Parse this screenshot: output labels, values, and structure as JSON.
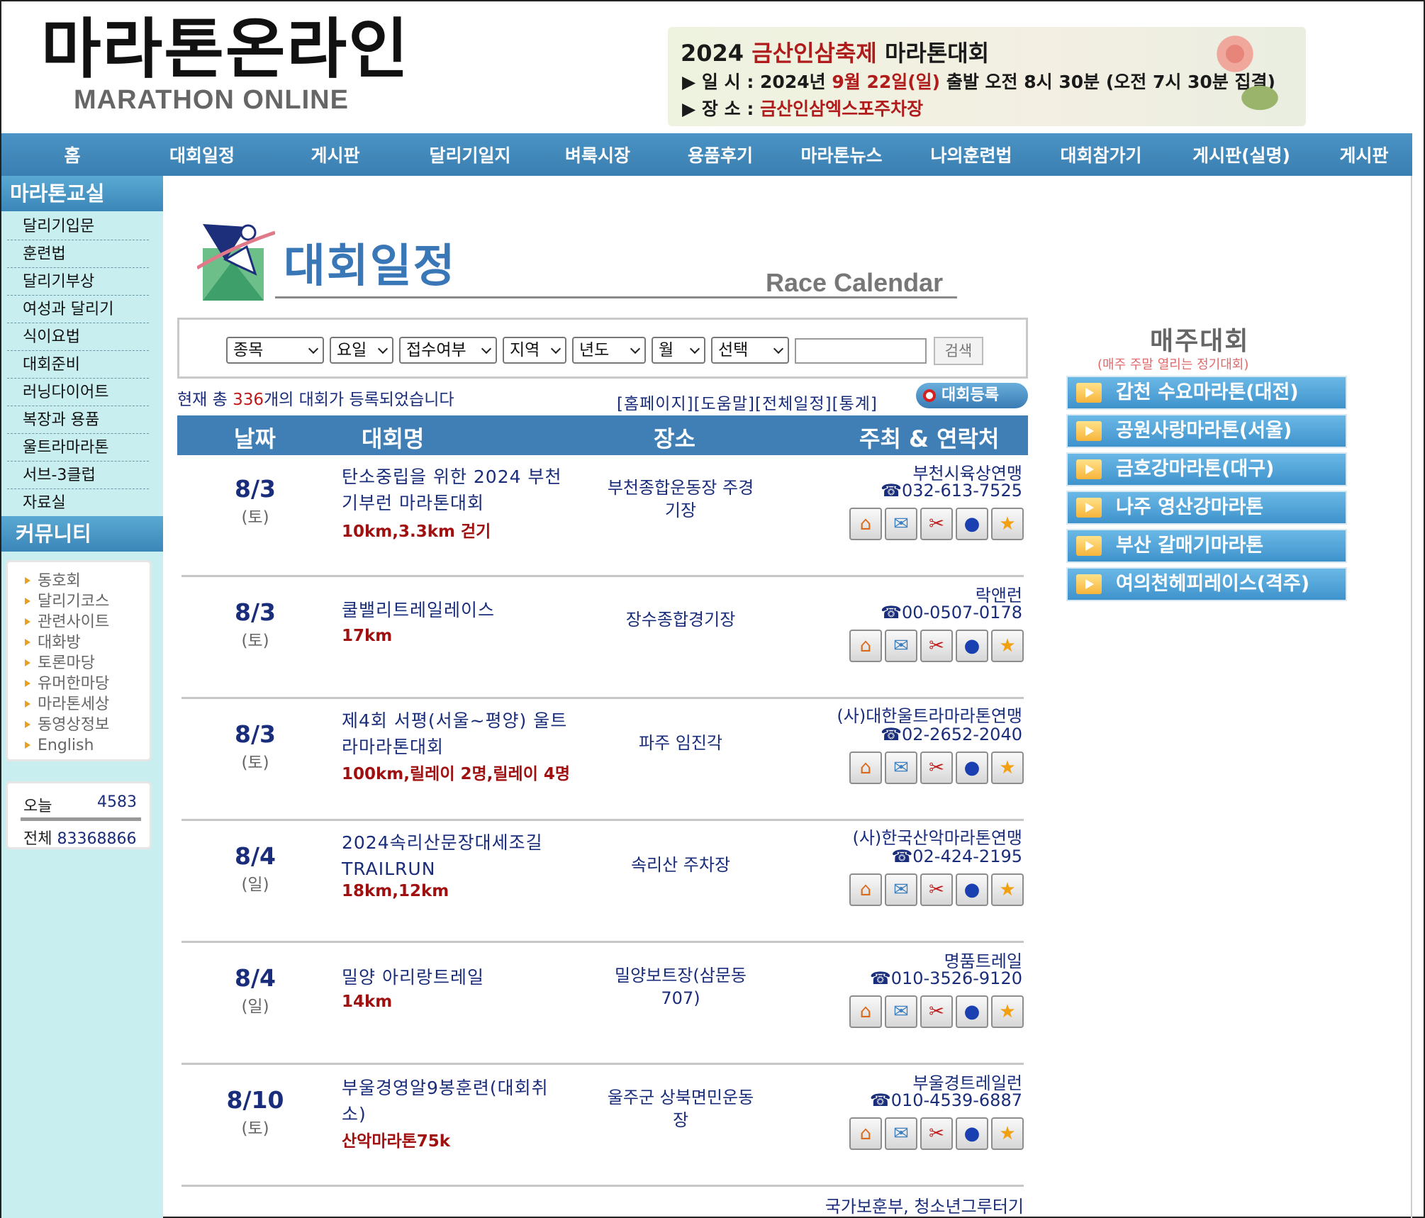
{
  "header": {
    "logo_kr": "마라톤온라인",
    "logo_en": "MARATHON ONLINE",
    "banner": {
      "title_year": "2024",
      "title_name": "금산인삼축제",
      "title_rest": "마라톤대회",
      "line1_label": "▶ 일  시 : 2024년",
      "line1_date": "9월 22일(일)",
      "line1_rest": "출발 오전 8시 30분 (오전 7시 30분 집결)",
      "line2_label": "▶ 장  소 :",
      "line2_place": "금산인삼엑스포주차장"
    }
  },
  "nav": [
    "홈",
    "대회일정",
    "게시판",
    "달리기일지",
    "벼룩시장",
    "용품후기",
    "마라톤뉴스",
    "나의훈련법",
    "대회참가기",
    "게시판(실명)",
    "게시판"
  ],
  "sidebar": {
    "section1": "마라톤교실",
    "menu": [
      "달리기입문",
      "훈련법",
      "달리기부상",
      "여성과 달리기",
      "식이요법",
      "대회준비",
      "러닝다이어트",
      "복장과 용품",
      "울트라마라톤",
      "서브-3클럽",
      "자료실"
    ],
    "section2": "커뮤니티",
    "community": [
      "동호회",
      "달리기코스",
      "관련사이트",
      "대화방",
      "토론마당",
      "유머한마당",
      "마라톤세상",
      "동영상정보",
      "English"
    ],
    "visitors": {
      "today_label": "오늘",
      "today_value": "4583",
      "total_label": "전체",
      "total_value": "83368866"
    }
  },
  "page": {
    "title": "대회일정",
    "subtitle": "Race Calendar"
  },
  "search": {
    "selects": [
      "종목",
      "요일",
      "접수여부",
      "지역",
      "년도",
      "월",
      "선택"
    ],
    "input_value": "",
    "button": "검색"
  },
  "summary": {
    "prefix": "현재 총 ",
    "count": "336",
    "suffix": "개의 대회가 등록되었습니다",
    "links": "[홈페이지][도움말][전체일정][통계]",
    "register": "대회등록"
  },
  "table": {
    "headers": [
      "날짜",
      "대회명",
      "장소",
      "주최 & 연락처"
    ],
    "rows": [
      {
        "date": "8/3",
        "day": "(토)",
        "name1": "탄소중립을 위한 2024 부천",
        "name2": "기부런 마라톤대회",
        "distance": "10km,3.3km 걷기",
        "place1": "부천종합운동장 주경",
        "place2": "기장",
        "org": "부천시육상연맹",
        "phone": "☎032-613-7525"
      },
      {
        "date": "8/3",
        "day": "(토)",
        "name1": "쿨밸리트레일레이스",
        "name2": "",
        "distance": "17km",
        "place1": "장수종합경기장",
        "place2": "",
        "org": "락앤런",
        "phone": "☎00-0507-0178"
      },
      {
        "date": "8/3",
        "day": "(토)",
        "name1": "제4회 서평(서울~평양) 울트",
        "name2": "라마라톤대회",
        "distance": "100km,릴레이 2명,릴레이 4명",
        "place1": "파주 임진각",
        "place2": "",
        "org": "(사)대한울트라마라톤연맹",
        "phone": "☎02-2652-2040"
      },
      {
        "date": "8/4",
        "day": "(일)",
        "name1": "2024속리산문장대세조길",
        "name2": "TRAILRUN",
        "distance": "18km,12km",
        "place1": "속리산 주차장",
        "place2": "",
        "org": "(사)한국산악마라톤연맹",
        "phone": "☎02-424-2195"
      },
      {
        "date": "8/4",
        "day": "(일)",
        "name1": "밀양 아리랑트레일",
        "name2": "",
        "distance": "14km",
        "place1": "밀양보트장(삼문동",
        "place2": "707)",
        "org": "명품트레일",
        "phone": "☎010-3526-9120"
      },
      {
        "date": "8/10",
        "day": "(토)",
        "name1": "부울경영알9봉훈련(대회취",
        "name2": "소)",
        "distance": "산악마라톤75k",
        "place1": "울주군 상북면민운동",
        "place2": "장",
        "org": "부울경트레일런",
        "phone": "☎010-4539-6887"
      }
    ],
    "partial_org": "국가보훈부, 청소년그루터기",
    "action_icons": [
      "home-icon",
      "mail-icon",
      "tools-icon",
      "info-icon",
      "star-icon"
    ]
  },
  "weekly": {
    "title": "매주대회",
    "subtitle": "(매주 주말 열리는 정기대회)",
    "items": [
      "갑천 수요마라톤(대전)",
      "공원사랑마라톤(서울)",
      "금호강마라톤(대구)",
      "나주 영산강마라톤",
      "부산 갈매기마라톤",
      "여의천헤피레이스(격주)"
    ]
  },
  "colors": {
    "nav": "#3f7fb6",
    "sidebar_bg": "#c8eef0",
    "link": "#1a2d7a",
    "accent_red": "#a01010"
  }
}
